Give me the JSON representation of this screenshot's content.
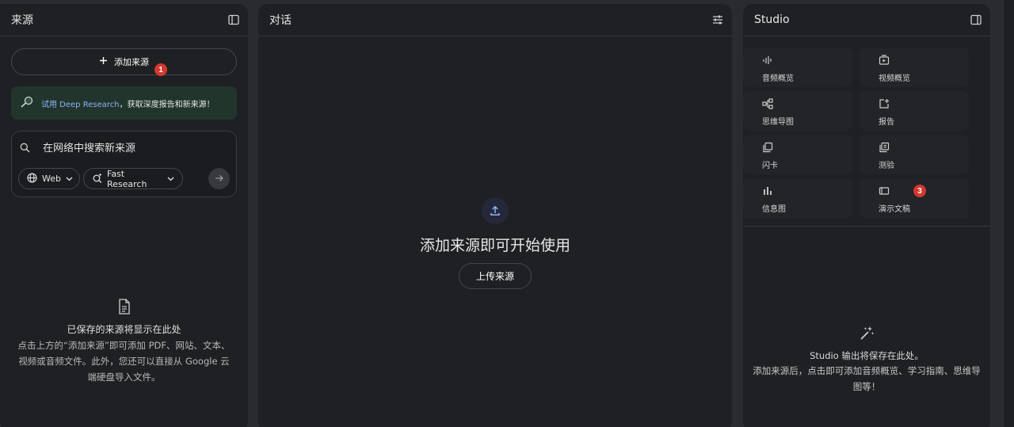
{
  "sources": {
    "title": "来源",
    "add_button": "添加来源",
    "badge_1": "1",
    "deep_research": {
      "link": "试用 Deep Research",
      "rest": "，获取深度报告和新来源！"
    },
    "search": {
      "placeholder": "在网络中搜索新来源",
      "web_chip": "Web",
      "fast_chip": "Fast Research"
    },
    "empty": {
      "title": "已保存的来源将显示在此处",
      "description": "点击上方的“添加来源”即可添加 PDF、网站、文本、视频或音频文件。此外，您还可以直接从 Google 云端硬盘导入文件。"
    }
  },
  "chat": {
    "title": "对话",
    "empty_title": "添加来源即可开始使用",
    "upload_button": "上传来源"
  },
  "studio": {
    "title": "Studio",
    "badge_3": "3",
    "tiles": [
      {
        "label": "音频概览",
        "icon": "audio-waveform-icon"
      },
      {
        "label": "视频概览",
        "icon": "video-icon"
      },
      {
        "label": "思维导图",
        "icon": "mind-map-icon"
      },
      {
        "label": "报告",
        "icon": "report-icon"
      },
      {
        "label": "闪卡",
        "icon": "flashcard-icon"
      },
      {
        "label": "测验",
        "icon": "quiz-icon"
      },
      {
        "label": "信息图",
        "icon": "infographic-icon"
      },
      {
        "label": "演示文稿",
        "icon": "slides-icon"
      }
    ],
    "empty": {
      "title": "Studio 输出将保存在此处。",
      "description": "添加来源后，点击即可添加音频概览、学习指南、思维导图等！"
    }
  },
  "colors": {
    "background": "#2a2b2e",
    "panel": "#1f2023",
    "accent_blue": "#8ab4f8",
    "badge_red": "#d3382f"
  }
}
